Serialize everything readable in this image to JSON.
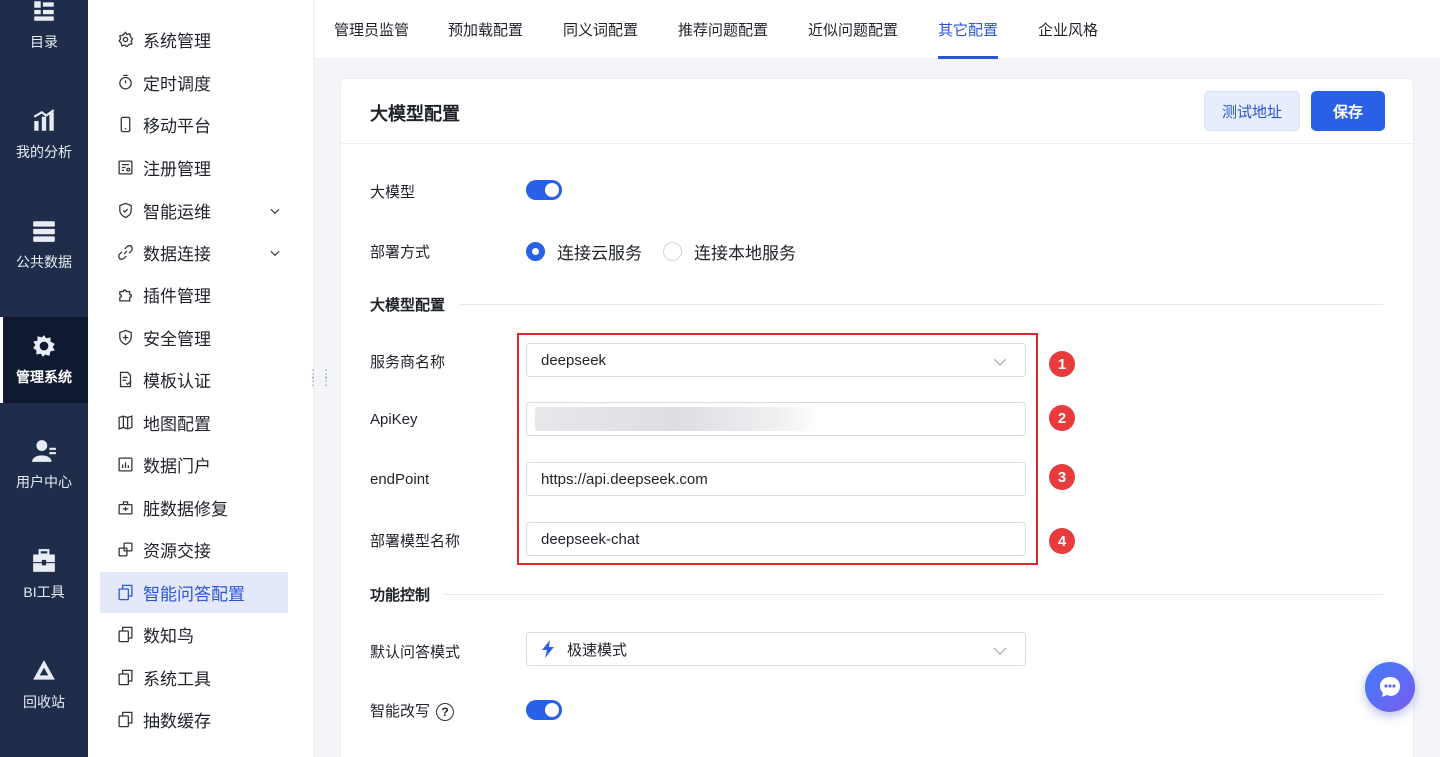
{
  "rail": {
    "items": [
      {
        "label": "目录",
        "icon": "catalog-icon"
      },
      {
        "label": "我的分析",
        "icon": "analysis-chart-icon"
      },
      {
        "label": "公共数据",
        "icon": "database-icon"
      },
      {
        "label": "管理系统",
        "icon": "gear-settings-icon",
        "active": true
      },
      {
        "label": "用户中心",
        "icon": "user-icon"
      },
      {
        "label": "BI工具",
        "icon": "toolbox-icon"
      },
      {
        "label": "回收站",
        "icon": "recycle-icon"
      }
    ]
  },
  "subnav": {
    "items": [
      {
        "label": "系统管理",
        "icon": "gear-icon"
      },
      {
        "label": "定时调度",
        "icon": "stopwatch-icon"
      },
      {
        "label": "移动平台",
        "icon": "mobile-icon"
      },
      {
        "label": "注册管理",
        "icon": "register-icon"
      },
      {
        "label": "智能运维",
        "icon": "smart-ops-icon",
        "expandable": true
      },
      {
        "label": "数据连接",
        "icon": "link-icon",
        "expandable": true
      },
      {
        "label": "插件管理",
        "icon": "puzzle-icon"
      },
      {
        "label": "安全管理",
        "icon": "shield-icon"
      },
      {
        "label": "模板认证",
        "icon": "template-icon"
      },
      {
        "label": "地图配置",
        "icon": "map-icon"
      },
      {
        "label": "数据门户",
        "icon": "portal-icon"
      },
      {
        "label": "脏数据修复",
        "icon": "repair-icon"
      },
      {
        "label": "资源交接",
        "icon": "handover-icon"
      },
      {
        "label": "智能问答配置",
        "icon": "copy-icon",
        "active": true
      },
      {
        "label": "数知鸟",
        "icon": "copy-icon"
      },
      {
        "label": "系统工具",
        "icon": "copy-icon"
      },
      {
        "label": "抽数缓存",
        "icon": "copy-icon"
      }
    ]
  },
  "tabs": [
    {
      "label": "管理员监管"
    },
    {
      "label": "预加载配置"
    },
    {
      "label": "同义词配置"
    },
    {
      "label": "推荐问题配置"
    },
    {
      "label": "近似问题配置"
    },
    {
      "label": "其它配置",
      "active": true
    },
    {
      "label": "企业风格"
    }
  ],
  "card": {
    "title": "大模型配置",
    "test_button": "测试地址",
    "save_button": "保存"
  },
  "form": {
    "llm_label": "大模型",
    "llm_enabled": true,
    "deploy_label": "部署方式",
    "deploy_options": [
      "连接云服务",
      "连接本地服务"
    ],
    "deploy_selected": "连接云服务",
    "section_llm": "大模型配置",
    "provider_label": "服务商名称",
    "provider_value": "deepseek",
    "apikey_label": "ApiKey",
    "endpoint_label": "endPoint",
    "endpoint_value": "https://api.deepseek.com",
    "model_label": "部署模型名称",
    "model_value": "deepseek-chat",
    "section_feature": "功能控制",
    "qa_mode_label": "默认问答模式",
    "qa_mode_value": "极速模式",
    "rewrite_label": "智能改写",
    "rewrite_help": "?",
    "rewrite_enabled": true
  },
  "annotations": {
    "badges": [
      "1",
      "2",
      "3",
      "4"
    ],
    "highlight_color": "#e0262b"
  },
  "colors": {
    "accent": "#2a5fe8",
    "rail_bg": "#1f2d4a",
    "active_subnav_bg": "#e3e9fb"
  }
}
